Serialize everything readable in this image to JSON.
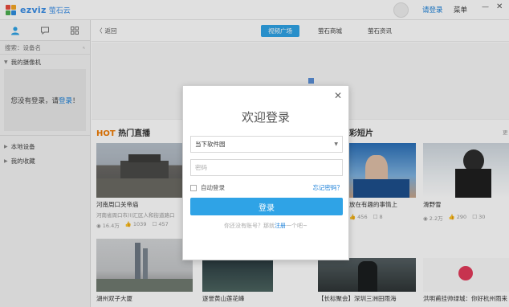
{
  "app": {
    "logo_text": "ezviz",
    "logo_cn": "萤石云",
    "login_label": "请登录",
    "menu_label": "菜单",
    "minimize_glyph": "—",
    "close_glyph": "✕",
    "brand_colors": [
      "#e84c3d",
      "#f5a623",
      "#4caf50",
      "#2f8fe0"
    ]
  },
  "sidebar": {
    "search_placeholder": "搜索：设备名",
    "my_cameras": "我的摄像机",
    "not_logged_prefix": "您没有登录，请",
    "not_logged_link": "登录",
    "not_logged_suffix": "！",
    "local_devices": "本地设备",
    "favorites": "我的收藏"
  },
  "nav": {
    "back_label": "返回",
    "tabs": [
      {
        "label": "视频广场",
        "active": true
      },
      {
        "label": "萤石商城",
        "active": false
      },
      {
        "label": "萤石资讯",
        "active": false
      }
    ]
  },
  "sections": {
    "hot_prefix": "HOT",
    "hot_title": "热门直播",
    "short_title": "彩短片",
    "more": "更"
  },
  "cards": [
    {
      "title": "河南周口关帝庙",
      "sub": "河南省周口市川汇区人和街道路口",
      "views": "16.4万",
      "likes": "1039",
      "comments": "457"
    },
    {
      "title": "放在有趣的事情上",
      "sub": "",
      "views": "",
      "likes": "456",
      "comments": "8"
    },
    {
      "title": "滑野雪",
      "sub": "",
      "views": "2.2万",
      "likes": "290",
      "comments": "30"
    },
    {
      "title": "湖州双子大厦",
      "sub": "",
      "views": "",
      "likes": "",
      "comments": ""
    },
    {
      "title": "逐誉黄山莲花峰",
      "sub": "",
      "views": "",
      "likes": "",
      "comments": ""
    },
    {
      "title": "【长标聚会】深圳三洲田雨海",
      "sub": "",
      "views": "",
      "likes": "",
      "comments": ""
    },
    {
      "title": "洪明甫挂帅绿城：你好杭州雨来",
      "sub": "",
      "views": "",
      "likes": "",
      "comments": ""
    }
  ],
  "dialog": {
    "title": "欢迎登录",
    "account_value": "当下软件园",
    "password_placeholder": "密码",
    "auto_login": "自动登录",
    "forgot": "忘记密码？",
    "login_button": "登录",
    "signup_prefix": "你还没有账号？那就",
    "signup_link": "注册",
    "signup_suffix": "一个吧~"
  }
}
